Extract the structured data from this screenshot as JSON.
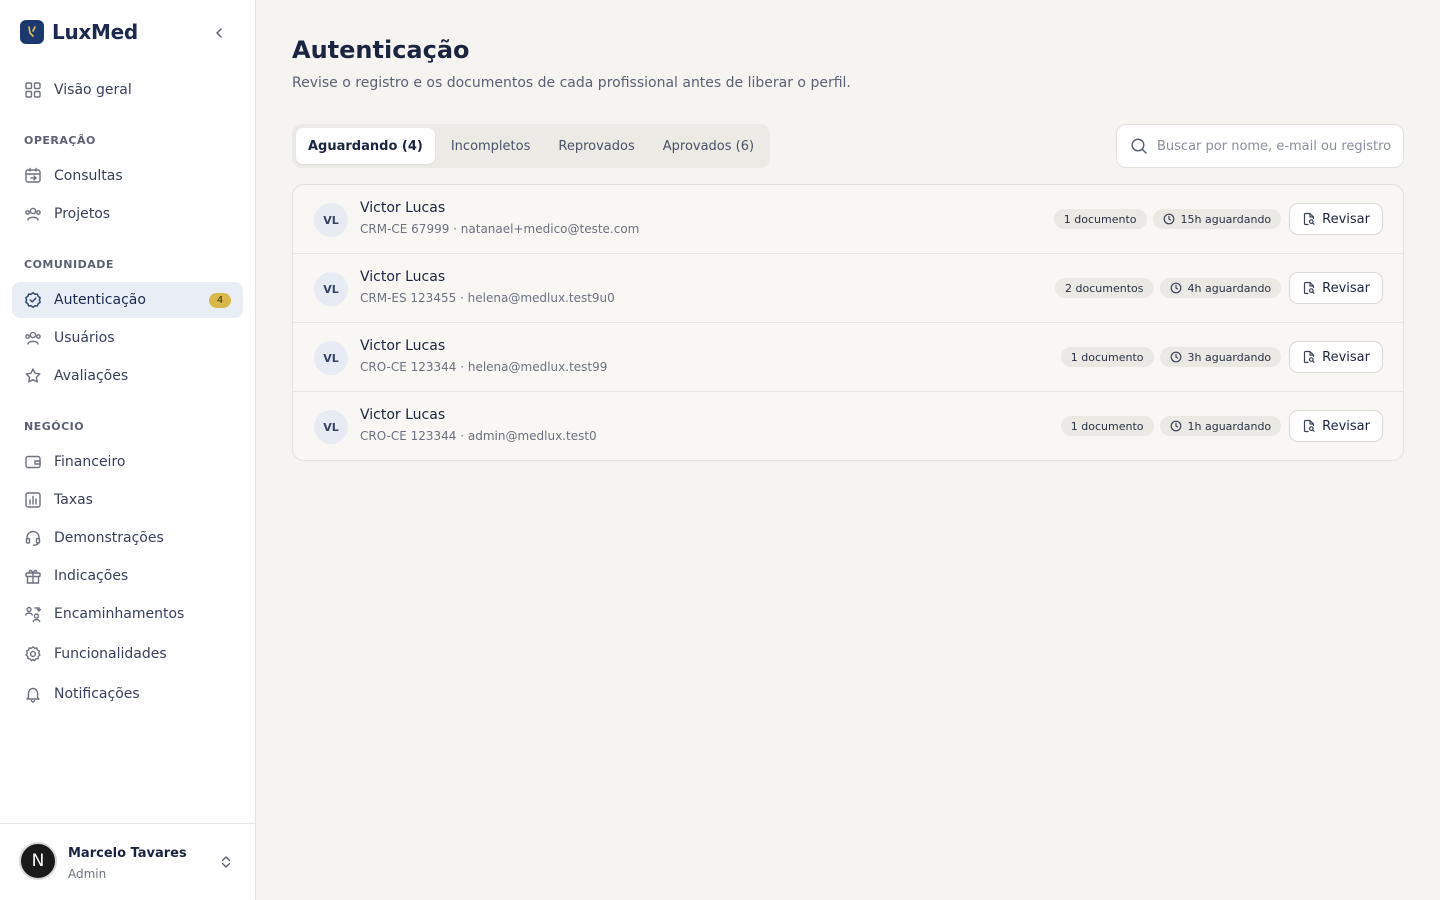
{
  "brand": {
    "name": "LuxMed"
  },
  "sidebar": {
    "overview": {
      "label": "Visão geral"
    },
    "sections": {
      "operacao": "OPERAÇÃO",
      "comunidade": "COMUNIDADE",
      "negocio": "NEGÓCIO"
    },
    "items": {
      "consultas": "Consultas",
      "projetos": "Projetos",
      "autenticacao": "Autenticação",
      "autenticacao_badge": "4",
      "usuarios": "Usuários",
      "avaliacoes": "Avaliações",
      "financeiro": "Financeiro",
      "taxas": "Taxas",
      "demonstracoes": "Demonstrações",
      "indicacoes": "Indicações",
      "encaminhamentos": "Encaminhamentos",
      "funcionalidades": "Funcionalidades",
      "notificacoes": "Notificações"
    },
    "active_item": "autenticacao"
  },
  "user": {
    "initial": "N",
    "name": "Marcelo Tavares",
    "role": "Admin"
  },
  "page": {
    "title": "Autenticação",
    "subtitle": "Revise o registro e os documentos de cada profissional antes de liberar o perfil."
  },
  "tabs": [
    {
      "label": "Aguardando (4)",
      "active": true
    },
    {
      "label": "Incompletos",
      "active": false
    },
    {
      "label": "Reprovados",
      "active": false
    },
    {
      "label": "Aprovados (6)",
      "active": false
    }
  ],
  "search": {
    "placeholder": "Buscar por nome, e-mail ou registro",
    "value": ""
  },
  "rows": [
    {
      "initials": "VL",
      "name": "Victor Lucas",
      "meta": "CRM-CE 67999 · natanael+medico@teste.com",
      "docs": "1 documento",
      "waiting": "15h aguardando",
      "action": "Revisar"
    },
    {
      "initials": "VL",
      "name": "Victor Lucas",
      "meta": "CRM-ES 123455 · helena@medlux.test9u0",
      "docs": "2 documentos",
      "waiting": "4h aguardando",
      "action": "Revisar"
    },
    {
      "initials": "VL",
      "name": "Victor Lucas",
      "meta": "CRO-CE 123344 · helena@medlux.test99",
      "docs": "1 documento",
      "waiting": "3h aguardando",
      "action": "Revisar"
    },
    {
      "initials": "VL",
      "name": "Victor Lucas",
      "meta": "CRO-CE 123344 · admin@medlux.test0",
      "docs": "1 documento",
      "waiting": "1h aguardando",
      "action": "Revisar"
    }
  ],
  "colors": {
    "brand": "#1d3a6e",
    "badge": "#d8b84a",
    "active_nav_bg": "#e9eef6",
    "background": "#f5f4f0"
  }
}
